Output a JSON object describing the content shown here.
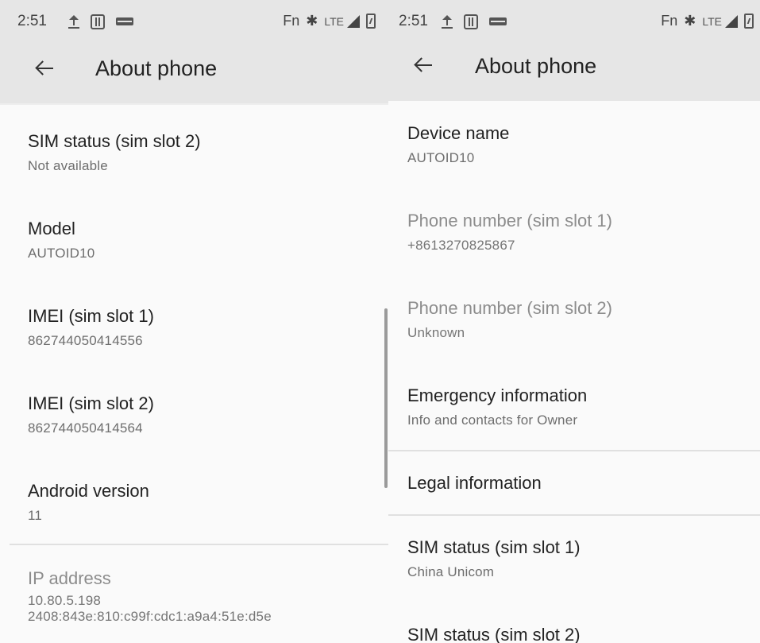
{
  "left": {
    "status_bar": {
      "time": "2:51",
      "fn_label": "Fn",
      "network_label": "LTE"
    },
    "toolbar": {
      "title": "About phone"
    },
    "items": [
      {
        "title": "SIM status (sim slot 2)",
        "summary": "Not available"
      },
      {
        "title": "Model",
        "summary": "AUTOID10"
      },
      {
        "title": "IMEI (sim slot 1)",
        "summary": "862744050414556"
      },
      {
        "title": "IMEI (sim slot 2)",
        "summary": "862744050414564"
      },
      {
        "title": "Android version",
        "summary": "11"
      },
      {
        "title": "IP address",
        "summary": "10.80.5.198",
        "summary2": "2408:843e:810:c99f:cdc1:a9a4:51e:d5e"
      }
    ]
  },
  "right": {
    "status_bar": {
      "time": "2:51",
      "fn_label": "Fn",
      "network_label": "LTE"
    },
    "toolbar": {
      "title": "About phone"
    },
    "items": [
      {
        "title": "Device name",
        "summary": "AUTOID10"
      },
      {
        "title": "Phone number (sim slot 1)",
        "summary": "+8613270825867"
      },
      {
        "title": "Phone number (sim slot 2)",
        "summary": "Unknown"
      },
      {
        "title": "Emergency information",
        "summary": "Info and contacts for Owner"
      },
      {
        "title": "Legal information"
      },
      {
        "title": "SIM status (sim slot 1)",
        "summary": "China Unicom"
      },
      {
        "title": "SIM status (sim slot 2)"
      }
    ]
  },
  "colors": {
    "app_bar": "#e6e6e6",
    "background": "#fafafa",
    "primary_text": "#222222",
    "secondary_text": "#6e6e6e",
    "disabled_text": "#8c8c8c"
  }
}
